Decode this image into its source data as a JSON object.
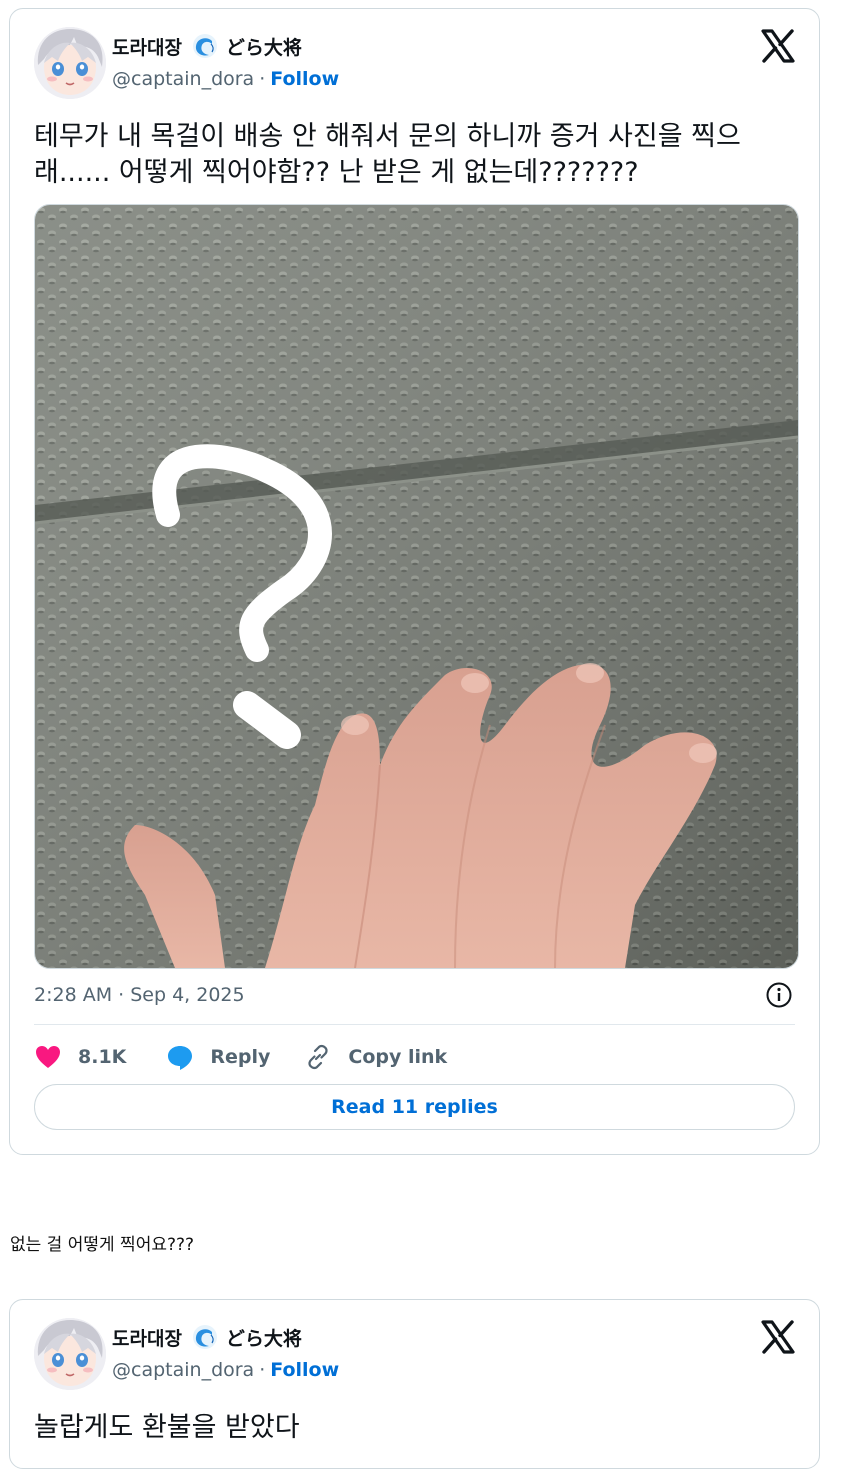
{
  "tweets": [
    {
      "display_name": "도라대장",
      "display_name_jp": "どら大将",
      "handle": "@captain_dora",
      "separator": "·",
      "follow_label": "Follow",
      "text": "테무가 내 목걸이 배송 안 해줘서 문의 하니까 증거 사진을 찍으\n래...... 어떻게 찍어야함?? 난 받은 게 없는데???????",
      "timestamp": "2:28 AM · Sep 4, 2025",
      "likes": "8.1K",
      "reply_label": "Reply",
      "copy_link_label": "Copy link",
      "read_replies_label": "Read 11 replies"
    },
    {
      "display_name": "도라대장",
      "display_name_jp": "どら大将",
      "handle": "@captain_dora",
      "separator": "·",
      "follow_label": "Follow",
      "text": "놀랍게도 환불을 받았다"
    }
  ],
  "caption": "없는 걸 어떻게 찍어요???",
  "icons": {
    "brand": "x-logo-icon",
    "badge": "wave-badge-icon",
    "like": "heart-icon",
    "reply": "speech-bubble-icon",
    "copy": "link-icon",
    "info": "info-icon"
  },
  "colors": {
    "link_blue": "#006fd6",
    "like_pink": "#f91880",
    "reply_blue": "#1d9bf0",
    "muted": "#536471",
    "border": "#cfd9de"
  }
}
